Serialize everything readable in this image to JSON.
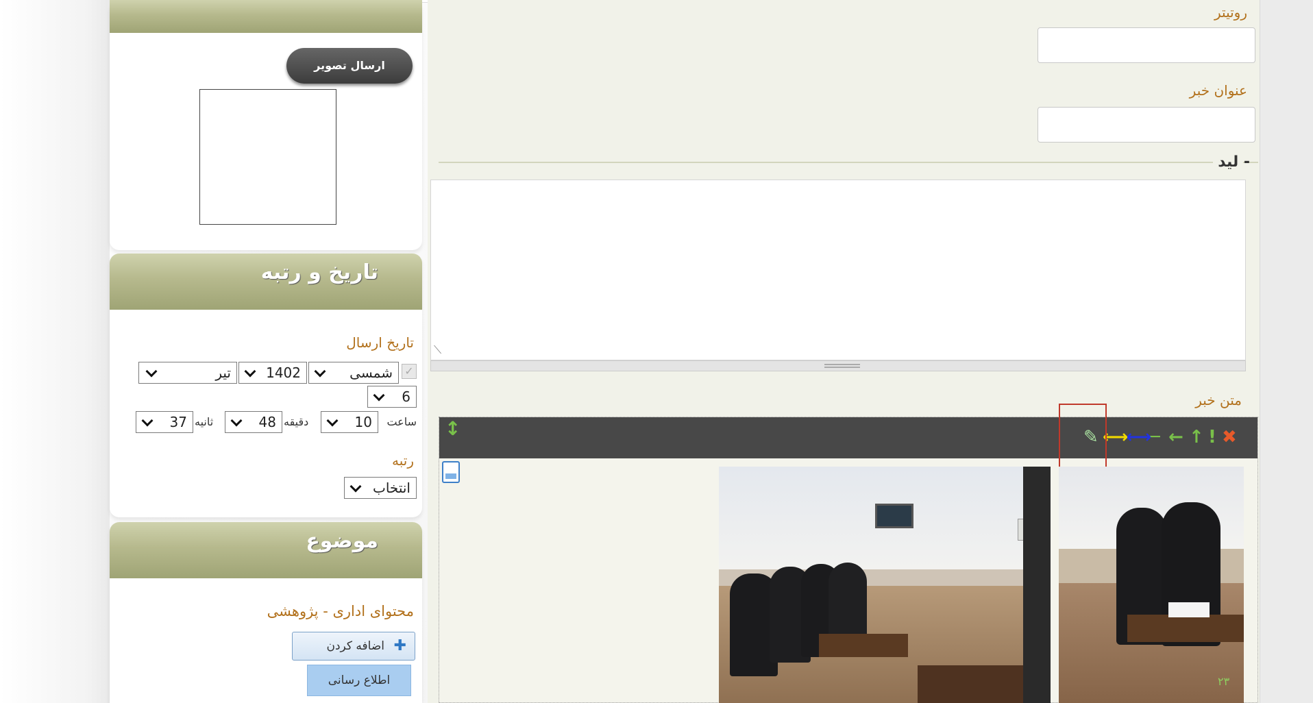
{
  "side": {
    "send_image_button": "ارسال تصویر",
    "date_panel": {
      "title": "تاریخ و رتبه",
      "send_date_label": "تاریخ ارسال",
      "calendar": "شمسی",
      "year": "1402",
      "month": "تیر",
      "day": "6",
      "hour_label": "ساعت",
      "hour": "10",
      "minute_label": "دقیقه",
      "minute": "48",
      "second_label": "ثانیه",
      "second": "37",
      "rank_label": "رتبه",
      "rank_value": "انتخاب"
    },
    "topic_panel": {
      "title": "موضوع",
      "topic_text": "محتوای اداری - پژوهشی",
      "add_button": "اضافه کردن",
      "notify_button": "اطلاع رسانی"
    }
  },
  "main": {
    "rotitr_label": "روتیتر",
    "title_label": "عنوان خبر",
    "lead_label": "- لید",
    "body_label": "متن خبر",
    "photo_caption": "۲۳"
  },
  "colors": {
    "panel_header": "#b6b98d",
    "label_gold": "#b2711c",
    "toolbar": "#484848",
    "highlight_box": "#c0392b"
  },
  "icons": [
    "delete-icon",
    "exclamation-icon",
    "arrow-up-icon",
    "arrow-left-icon",
    "dash-icon",
    "arrow-double-blue-icon",
    "arrow-double-yellow-icon",
    "edit-pencil-icon",
    "move-vertical-icon",
    "document-icon"
  ]
}
